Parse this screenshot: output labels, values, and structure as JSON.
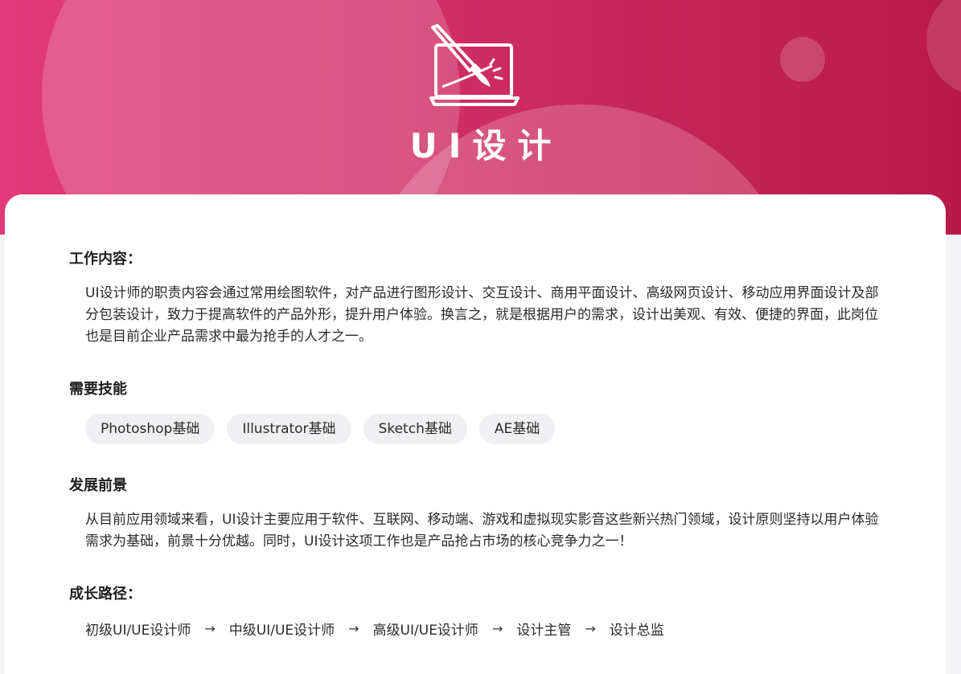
{
  "hero": {
    "title": "UI设计",
    "icon": "laptop-paintbrush-icon",
    "colors": {
      "gradient_start": "#e23a78",
      "gradient_end": "#b8194a"
    }
  },
  "sections": {
    "work": {
      "title": "工作内容：",
      "text": "UI设计师的职责内容会通过常用绘图软件，对产品进行图形设计、交互设计、商用平面设计、高级网页设计、移动应用界面设计及部分包装设计，致力于提高软件的产品外形，提升用户体验。换言之，就是根据用户的需求，设计出美观、有效、便捷的界面，此岗位也是目前企业产品需求中最为抢手的人才之一。"
    },
    "skills": {
      "title": "需要技能",
      "tags": [
        "Photoshop基础",
        "Illustrator基础",
        "Sketch基础",
        "AE基础"
      ]
    },
    "prospect": {
      "title": "发展前景",
      "text": "从目前应用领域来看，UI设计主要应用于软件、互联网、移动端、游戏和虚拟现实影音这些新兴热门领域，设计原则坚持以用户体验需求为基础，前景十分优越。同时，UI设计这项工作也是产品抢占市场的核心竞争力之一！"
    },
    "path": {
      "title": "成长路径：",
      "steps": [
        "初级UI/UE设计师",
        "中级UI/UE设计师",
        "高级UI/UE设计师",
        "设计主管",
        "设计总监"
      ],
      "arrow": "→"
    }
  }
}
